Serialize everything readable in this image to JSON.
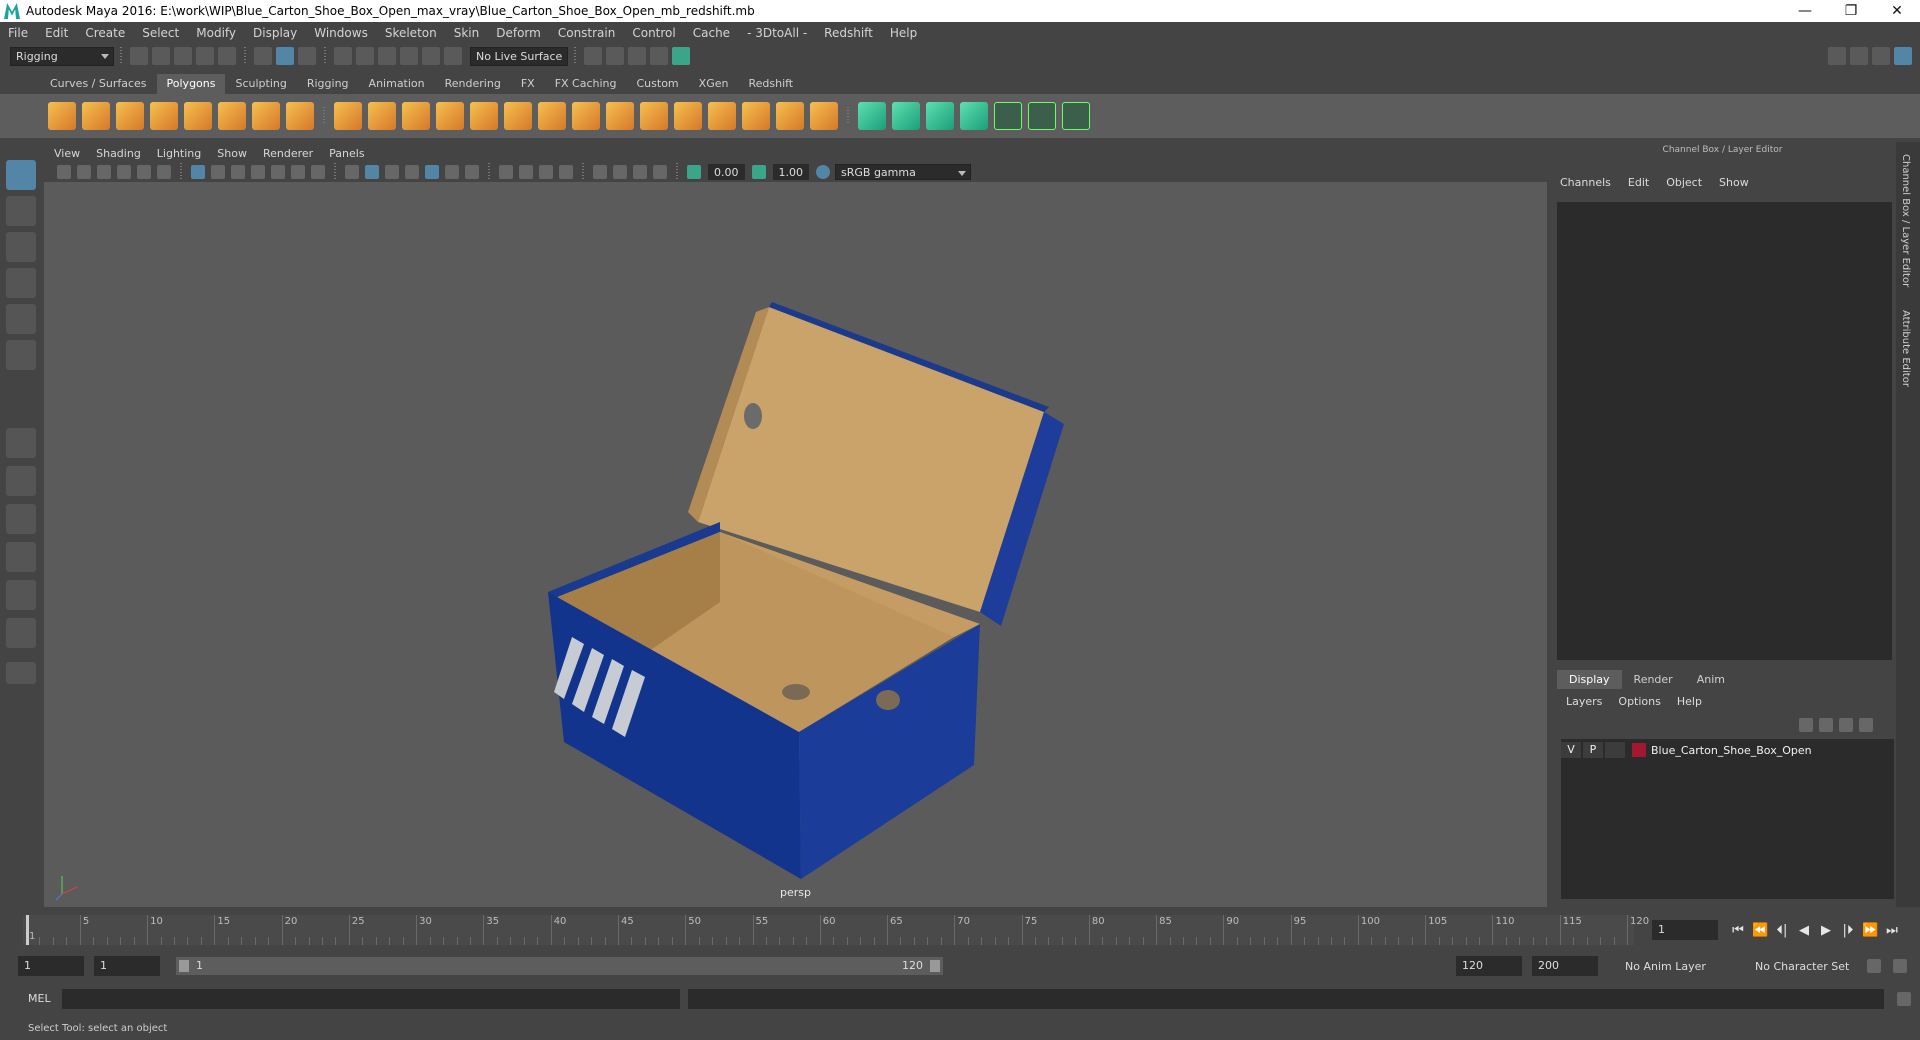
{
  "window": {
    "title": "Autodesk Maya 2016: E:\\work\\WIP\\Blue_Carton_Shoe_Box_Open_max_vray\\Blue_Carton_Shoe_Box_Open_mb_redshift.mb",
    "minimize": "—",
    "restore": "❐",
    "close": "✕"
  },
  "menubar": [
    "File",
    "Edit",
    "Create",
    "Select",
    "Modify",
    "Display",
    "Windows",
    "Skeleton",
    "Skin",
    "Deform",
    "Constrain",
    "Control",
    "Cache",
    "- 3DtoAll -",
    "Redshift",
    "Help"
  ],
  "statusline": {
    "menuset": "Rigging",
    "live_surface": "No Live Surface"
  },
  "shelf": {
    "tabs": [
      "Curves / Surfaces",
      "Polygons",
      "Sculpting",
      "Rigging",
      "Animation",
      "Rendering",
      "FX",
      "FX Caching",
      "Custom",
      "XGen",
      "Redshift"
    ],
    "active_tab": "Polygons"
  },
  "viewport": {
    "menu": [
      "View",
      "Shading",
      "Lighting",
      "Show",
      "Renderer",
      "Panels"
    ],
    "exposure": "0.00",
    "gamma": "1.00",
    "colorspace": "sRGB gamma",
    "camera_label": "persp"
  },
  "channelbox": {
    "title": "Channel Box / Layer Editor",
    "menu": [
      "Channels",
      "Edit",
      "Object",
      "Show"
    ],
    "side_tabs": [
      "Channel Box / Layer Editor",
      "Attribute Editor"
    ]
  },
  "layers": {
    "tabs": [
      "Display",
      "Render",
      "Anim"
    ],
    "active_tab": "Display",
    "menu": [
      "Layers",
      "Options",
      "Help"
    ],
    "rows": [
      {
        "v": "V",
        "p": "P",
        "name": "Blue_Carton_Shoe_Box_Open",
        "color": "#a31830"
      }
    ]
  },
  "timeline": {
    "tick_labels": [
      "1",
      "5",
      "10",
      "15",
      "20",
      "25",
      "30",
      "35",
      "40",
      "45",
      "50",
      "55",
      "60",
      "65",
      "70",
      "75",
      "80",
      "85",
      "90",
      "95",
      "100",
      "105",
      "110",
      "115",
      "120"
    ],
    "current_frame": "1",
    "playback_buttons": [
      "⏮",
      "⏪",
      "⏴|",
      "◀",
      "▶",
      "|⏵",
      "⏩",
      "⏭"
    ]
  },
  "range": {
    "start": "1",
    "playback_start": "1",
    "slider_start": "1",
    "slider_end": "120",
    "playback_end": "120",
    "end": "200",
    "anim_layer": "No Anim Layer",
    "char_set": "No Character Set"
  },
  "cmdline": {
    "lang": "MEL"
  },
  "status": {
    "help": "Select Tool: select an object"
  }
}
